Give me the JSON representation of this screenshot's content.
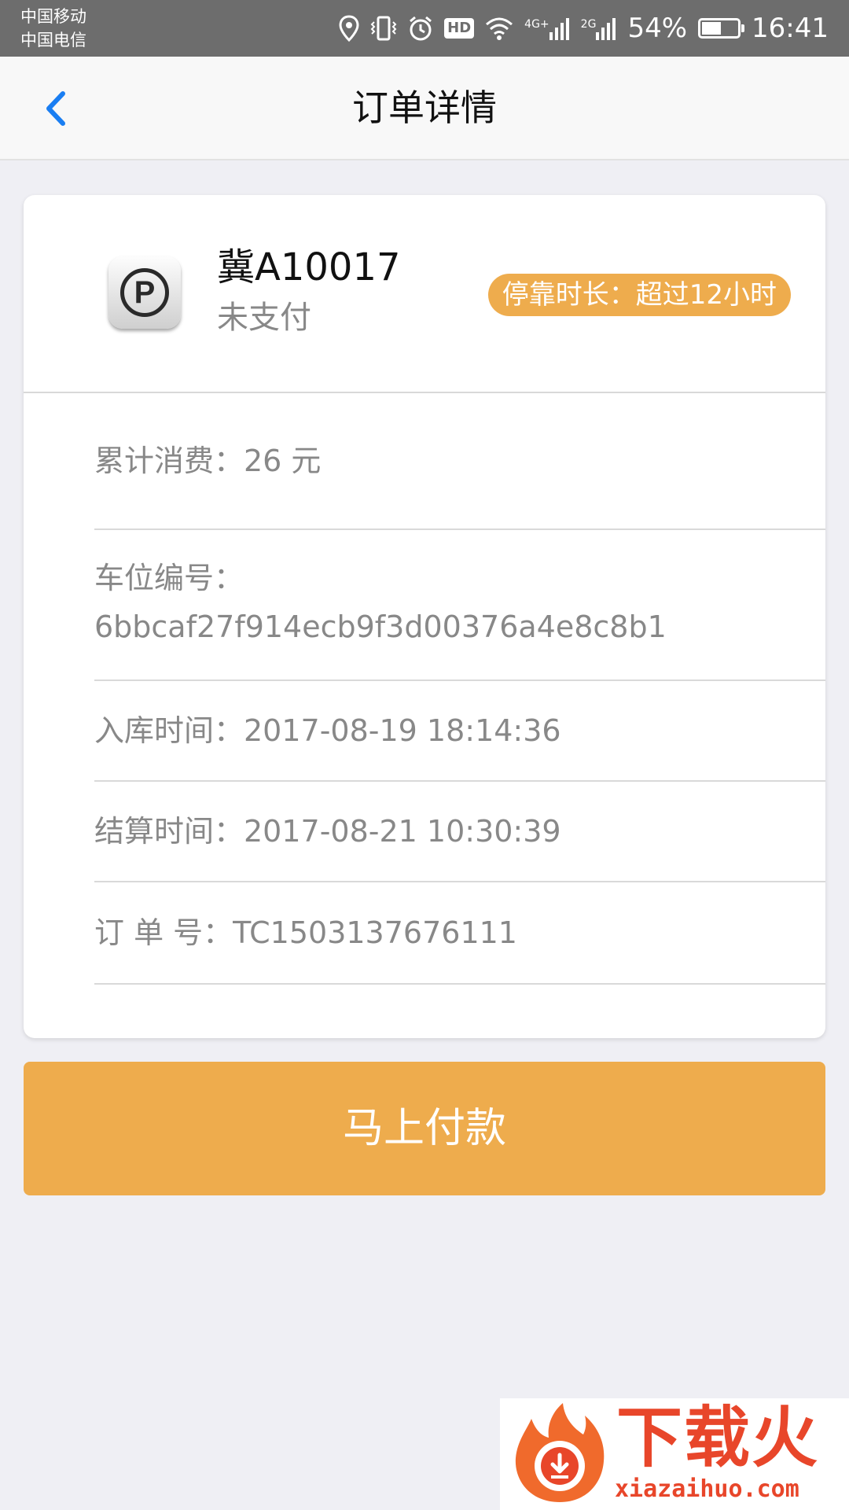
{
  "status_bar": {
    "carrier_1": "中国移动",
    "carrier_2": "中国电信",
    "hd": "HD",
    "net_1": "4G+",
    "net_2": "2G",
    "battery": "54%",
    "battery_level": 0.54,
    "time": "16:41",
    "icons": [
      "location-icon",
      "vibrate-icon",
      "alarm-icon",
      "hd-icon",
      "wifi-icon",
      "signal-icon",
      "signal-icon",
      "battery-icon"
    ]
  },
  "nav": {
    "title": "订单详情",
    "back_icon": "chevron-left-icon"
  },
  "order": {
    "plate": "冀A10017",
    "pay_status": "未支付",
    "duration": "停靠时长：超过12小时",
    "details": {
      "total": "累计消费：26 元",
      "space_label": "车位编号：",
      "space_value": "6bbcaf27f914ecb9f3d00376a4e8c8b1",
      "checkin": "入库时间：2017-08-19 18:14:36",
      "checkout": "结算时间：2017-08-21 10:30:39",
      "order_no": "订 单 号：TC1503137676111"
    }
  },
  "actions": {
    "pay_button": "马上付款"
  },
  "watermark": {
    "brand": "下载火",
    "domain": "xiazaihuo.com"
  },
  "colors": {
    "accent": "#eeac4d",
    "nav_back": "#1a7ef2",
    "background": "#efeff4",
    "status_bar": "#6d6d6d"
  }
}
